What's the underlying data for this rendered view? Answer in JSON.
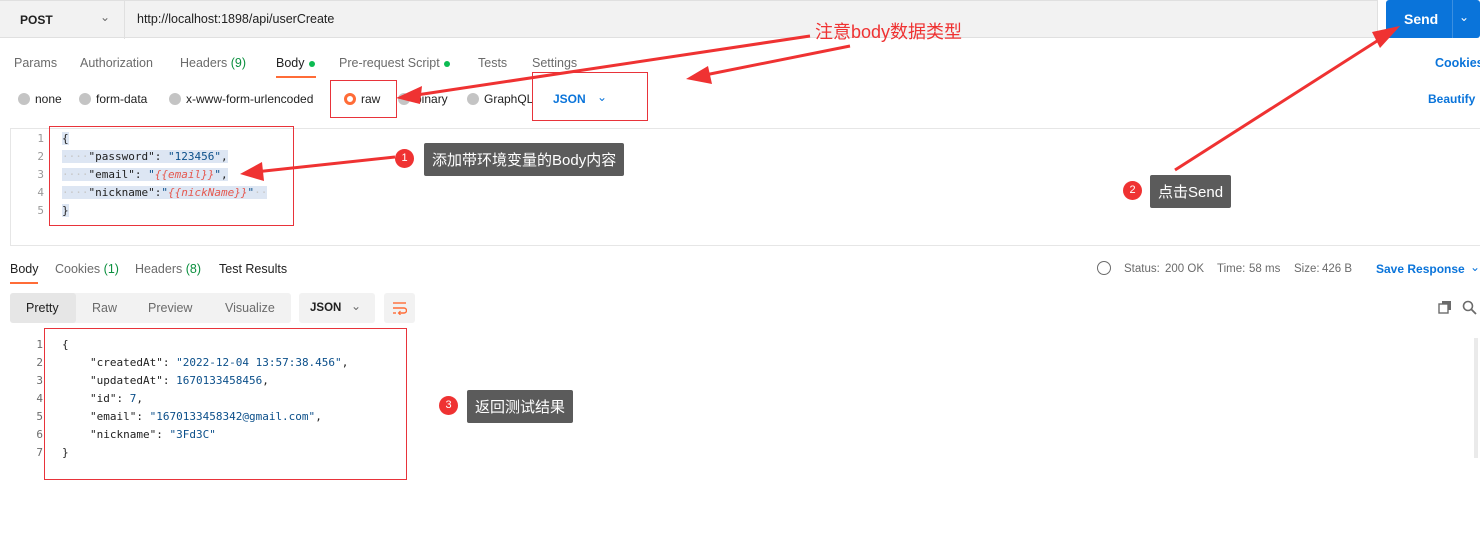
{
  "request": {
    "method": "POST",
    "url": "http://localhost:1898/api/userCreate",
    "send_label": "Send",
    "tabs": [
      {
        "label": "Params"
      },
      {
        "label": "Authorization"
      },
      {
        "label": "Headers",
        "count": "(9)"
      },
      {
        "label": "Body"
      },
      {
        "label": "Pre-request Script"
      },
      {
        "label": "Tests"
      },
      {
        "label": "Settings"
      }
    ],
    "cookies_label": "Cookies",
    "body_types": [
      "none",
      "form-data",
      "x-www-form-urlencoded",
      "raw",
      "binary",
      "GraphQL"
    ],
    "body_language": "JSON",
    "beautify_label": "Beautify",
    "body_lines": [
      "1",
      "2",
      "3",
      "4",
      "5"
    ],
    "body_code": {
      "open": "{",
      "k1": "\"password\"",
      "v1": "\"123456\"",
      "k2": "\"email\"",
      "v2q1": "\"",
      "v2": "{{email}}",
      "v2q2": "\"",
      "k3": "\"nickname\"",
      "v3q1": "\"",
      "v3": "{{nickName}}",
      "v3q2": "\"",
      "close": "}"
    }
  },
  "response": {
    "tabs": [
      {
        "label": "Body"
      },
      {
        "label": "Cookies",
        "count": "(1)"
      },
      {
        "label": "Headers",
        "count": "(8)"
      },
      {
        "label": "Test Results"
      }
    ],
    "status_label": "Status:",
    "status_value": "200 OK",
    "time_label": "Time:",
    "time_value": "58 ms",
    "size_label": "Size:",
    "size_value": "426 B",
    "save_label": "Save Response",
    "view_tabs": [
      "Pretty",
      "Raw",
      "Preview",
      "Visualize"
    ],
    "format": "JSON",
    "lines": [
      "1",
      "2",
      "3",
      "4",
      "5",
      "6",
      "7"
    ],
    "code": {
      "open": "{",
      "k1": "\"createdAt\"",
      "v1": "\"2022-12-04 13:57:38.456\"",
      "k2": "\"updatedAt\"",
      "v2": "1670133458456",
      "k3": "\"id\"",
      "v3": "7",
      "k4": "\"email\"",
      "v4": "\"1670133458342@gmail.com\"",
      "k5": "\"nickname\"",
      "v5": "\"3Fd3C\"",
      "close": "}"
    }
  },
  "annotations": {
    "top_note": "注意body数据类型",
    "step1_num": "1",
    "step1_text": "添加带环境变量的Body内容",
    "step2_num": "2",
    "step2_text": "点击Send",
    "step3_num": "3",
    "step3_text": "返回测试结果",
    "color": "#ef3232"
  },
  "colors": {
    "accent": "#ff6c37",
    "primary": "#0a74da",
    "success": "#0a8f3e"
  }
}
